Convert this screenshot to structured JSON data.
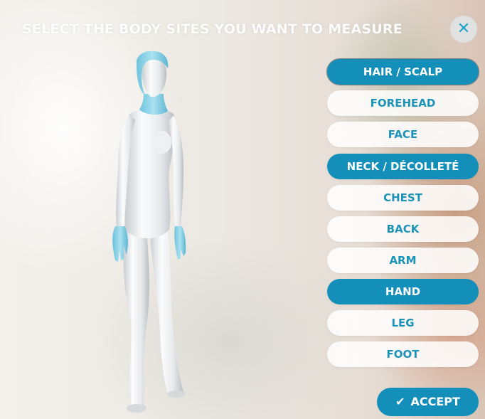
{
  "header": {
    "title": "SELECT THE BODY SITES YOU WANT TO MEASURE",
    "close_icon": "close-icon",
    "close_glyph": "✕"
  },
  "body_sites": [
    {
      "label": "HAIR / SCALP",
      "selected": true
    },
    {
      "label": "FOREHEAD",
      "selected": false
    },
    {
      "label": "FACE",
      "selected": false
    },
    {
      "label": "NECK / DÉCOLLETÉ",
      "selected": true
    },
    {
      "label": "CHEST",
      "selected": false
    },
    {
      "label": "BACK",
      "selected": false
    },
    {
      "label": "ARM",
      "selected": false
    },
    {
      "label": "HAND",
      "selected": true
    },
    {
      "label": "LEG",
      "selected": false
    },
    {
      "label": "FOOT",
      "selected": false
    }
  ],
  "accept": {
    "label": "ACCEPT",
    "icon": "checkmark-icon",
    "glyph": "✔"
  },
  "colors": {
    "accent": "#148fba",
    "text_unselected": "#1b93b8",
    "highlight": "#8fd3e6"
  }
}
